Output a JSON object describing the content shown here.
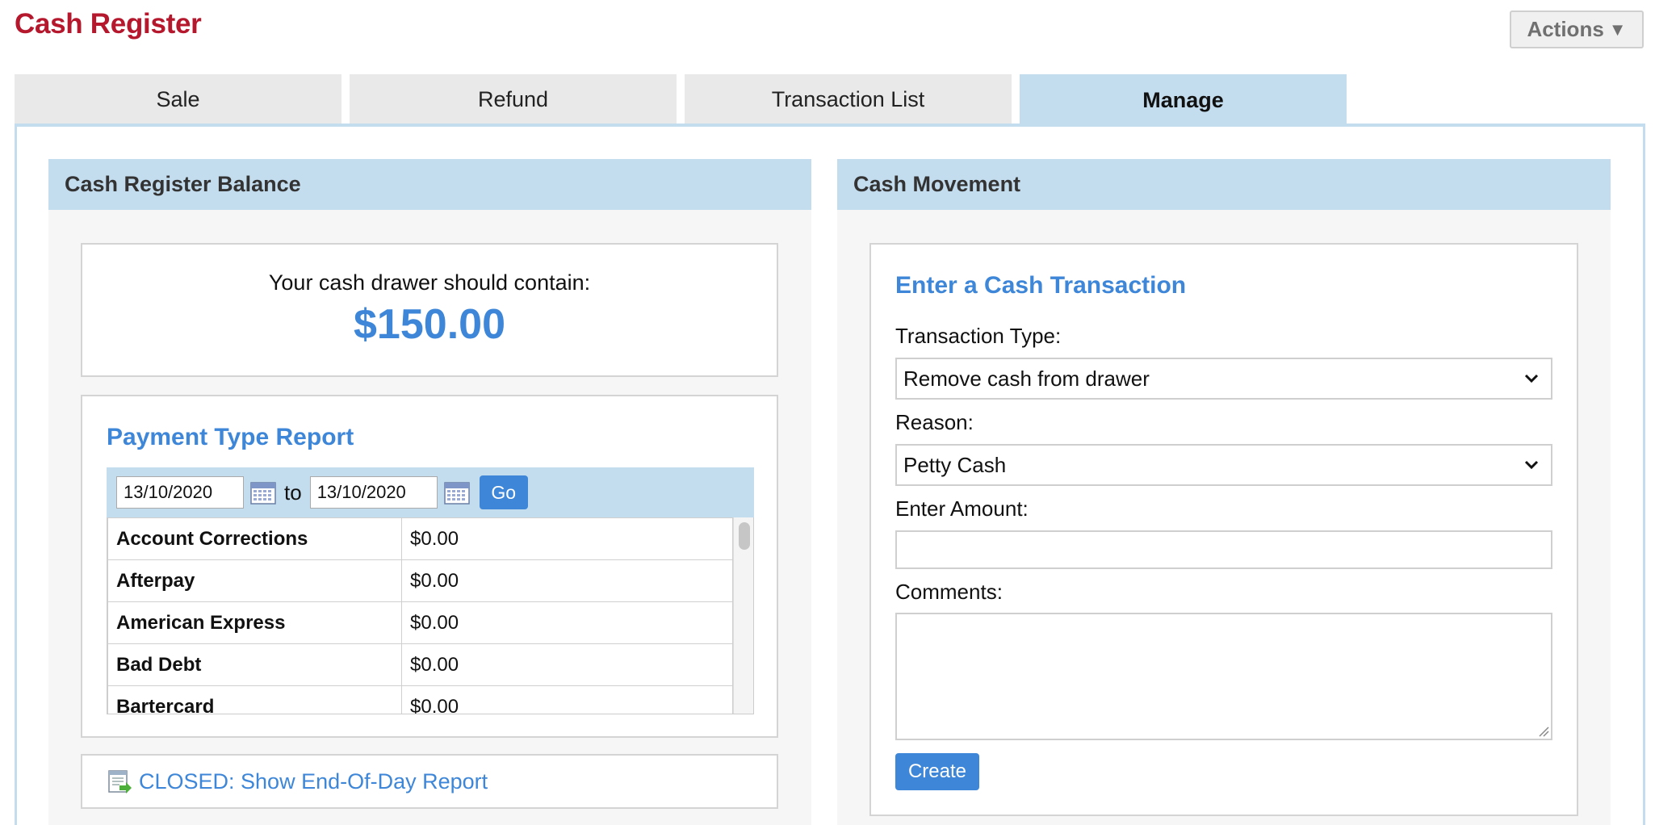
{
  "header": {
    "title": "Cash Register",
    "actions_label": "Actions"
  },
  "tabs": [
    {
      "label": "Sale",
      "active": false
    },
    {
      "label": "Refund",
      "active": false
    },
    {
      "label": "Transaction List",
      "active": false
    },
    {
      "label": "Manage",
      "active": true
    }
  ],
  "balance_panel": {
    "header": "Cash Register Balance",
    "drawer_label": "Your cash drawer should contain:",
    "drawer_amount": "$150.00",
    "report": {
      "title": "Payment Type Report",
      "date_from": "13/10/2020",
      "to_label": "to",
      "date_to": "13/10/2020",
      "go_label": "Go",
      "rows": [
        {
          "name": "Account Corrections",
          "amount": "$0.00"
        },
        {
          "name": "Afterpay",
          "amount": "$0.00"
        },
        {
          "name": "American Express",
          "amount": "$0.00"
        },
        {
          "name": "Bad Debt",
          "amount": "$0.00"
        },
        {
          "name": "Bartercard",
          "amount": "$0.00"
        }
      ]
    },
    "eod_link": "CLOSED: Show End-Of-Day Report"
  },
  "cash_panel": {
    "header": "Cash Movement",
    "form_title": "Enter a Cash Transaction",
    "transaction_type_label": "Transaction Type:",
    "transaction_type_value": "Remove cash from drawer",
    "reason_label": "Reason:",
    "reason_value": "Petty Cash",
    "amount_label": "Enter Amount:",
    "amount_value": "",
    "comments_label": "Comments:",
    "comments_value": "",
    "create_label": "Create"
  },
  "colors": {
    "brand_red": "#b5172d",
    "accent_blue": "#3d86d8",
    "panel_header_bg": "#c3dcee"
  }
}
